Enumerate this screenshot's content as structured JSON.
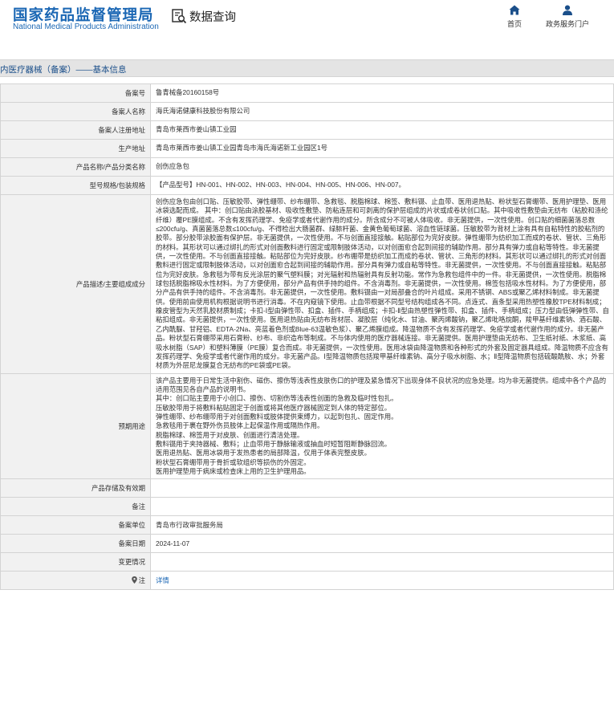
{
  "header": {
    "logo_title": "国家药品监督管理局",
    "logo_subtitle": "National Medical Products Administration",
    "query_label": "数据查询",
    "query_icon": "document-search-icon",
    "nav": [
      {
        "label": "首页",
        "icon": "home-icon"
      },
      {
        "label": "政务服务门户",
        "icon": "user-icon"
      }
    ]
  },
  "section": {
    "title": "内医疗器械（备案）——基本信息"
  },
  "rows": {
    "record_no": {
      "label": "备案号",
      "value": "鲁青械备20160158号"
    },
    "applicant": {
      "label": "备案人名称",
      "value": "海氏海诺健康科技股份有限公司"
    },
    "reg_address": {
      "label": "备案人注册地址",
      "value": "青岛市莱西市姜山镇工业园"
    },
    "prod_address": {
      "label": "生产地址",
      "value": "青岛市莱西市姜山镇工业园青岛市海氏海诺新工业园区1号"
    },
    "product_name": {
      "label": "产品名称/产品分类名称",
      "value": "创伤应急包"
    },
    "model_spec": {
      "label": "型号规格/包装规格",
      "value": "【产品型号】HN-001、HN-002、HN-003、HN-004、HN-005、HN-006、HN-007。"
    },
    "description": {
      "label": "产品描述/主要组成成分",
      "value": "创伤应急包由创口贴、压敏胶带、弹性绷带、纱布绷带、急救毯、脱脂棉球、棉签、敷料镊、止血带、医用退热贴、粉状型石膏绷带、医用护理垫、医用冰袋选配而成。 其中：创口贴由涂胶基材、吸收性敷垫、防粘连层和可剥离的保护层组成的片状或成卷状创口贴。其中吸收性敷垫由无纺布（粘胶和涤纶纤维）覆PE膜组成。不含有发挥药理学、免疫学或者代谢作用的成分。所含成分不可被人体吸收。非无菌提供，一次性使用。创口贴的细菌菌落总数≤200cfu/g、真菌菌落总数≤100cfu/g、不得检出大肠菌群、绿脓杆菌、金黄色葡萄球菌、溶血性链球菌。压敏胶带为背材上涂有具有自粘特性的胶粘剂的胶带。部分胶带涂胶面有保护层。非无菌提供，一次性使用。不与创面直接接触。粘贴部位为完好皮肤。弹性绷带为纺织加工而成的卷状、管状、三角形的材料。其形状可以通过绑扎的形式对创面敷料进行固定或限制肢体活动，以对创面愈合起到间接的辅助作用。部分具有弹力或自粘等特性。非无菌提供，一次性使用。不与创面直接接触。粘贴部位为完好皮肤。纱布绷带是纺织加工而成的卷状、管状、三角形的材料。其形状可以通过绑扎的形式对创面敷料进行固定或限制肢体活动，以对创面愈合起到间接的辅助作用。部分具有弹力或自粘等特性。非无菌提供，一次性使用。不与创面直接接触。粘贴部位为完好皮肤。急救毯为带有反光涂层的聚气塑料膜；对光辐射和热辐射具有反射功能。常作为急救包组件中的一件。非无菌提供，一次性使用。脱脂棉球包括脱脂棉吸水性材料。为了方便使用，部分产品有供手持的组件。不含消毒剂。非无菌提供，一次性使用。棉签包括吸水性材料。为了方便使用，部分产品有供手持的组件。不含消毒剂。非无菌提供，一次性使用。敷料镊由一对局部叠合的叶片组成。采用不锈钢、ABS或聚乙烯材料制成。非无菌提供。使用前由使用机构根据说明书进行消毒。不在内窥镜下使用。止血带根据不同型号结构组成各不同。点连式、直条型采用热塑性橡胶TPE材料制成；橡皮管型为天然乳胶材质制成；卡扣-Ⅰ型由弹性带、扣盒、插件、手柄组成；卡扣-Ⅱ型由热塑性弹性带、扣盒、插件、手柄组成；压力型由低弹弹性带、自粘扣组成。非无菌提供，一次性使用。医用退热贴由无纺布背材层、凝胶层（纯化水、甘油、聚丙烯酸钠，聚乙烯吡咯烷酮，羧甲基纤维素钠、酒石酸、乙内酰脲、甘羟铝、EDTA-2Na、亮蓝着色剂或Blue-63温敏色浆）、聚乙烯膜组成。降温物质不含有发挥药理学、免疫学或者代谢作用的成分。非无菌产品。粉状型石膏绷带采用石膏粉、纱布、非织造布等制成。不与体内使用的医疗器械连接。非无菌提供。医用护理垫由无纺布、卫生纸衬纸、木浆纸、高吸水树脂（SAP）和塑料薄膜（PE膜）复合而成。非无菌提供，一次性使用。医用冰袋由降温物质和各种形式的外套及固定器具组成。降温物质不应含有发挥药理学、免疫学或者代谢作用的成分。非无菌产品。Ⅰ型降温物质包括羧甲基纤维素钠、高分子吸水树脂、水；Ⅱ型降温物质包括硫酸酰胺、水；外套材质为外层尼龙膜复合无纺布的PE袋或PE袋。"
    },
    "intended_use": {
      "label": "预期用途",
      "lines": [
        "该产品主要用于日常生活中割伤、磁伤、擦伤等浅表性皮肤伤口的护理及紧急情况下出现身体不良状况的应急处理。均为非无菌提供。组成中各个产品的适用范围见各自产品的说明书。",
        "其中：创口贴主要用于小创口、擦伤、切割伤等浅表性创面的急救及临时性包扎。",
        "压敏胶带用于将敷料粘贴固定于创面或将其他医疗器械固定到人体的特定部位。",
        "弹性绷带、纱布绷带用于对创面敷料或肢体提供束缚力，以起到包扎、固定作用。",
        "急救毯用于裹在野外伤员肢体上起保温作用或隔热作用。",
        "脱脂棉球、棉签用于对皮肤、创面进行清洁处理。",
        "敷料镊用于夹持器械、敷料；止血带用于静脉输液或抽血时短暂阻断静脉回流。",
        "医用退热贴、医用冰袋用于发热患者的局部降温，仅用于体表完整皮肤。",
        "粉状型石膏绷带用于骨折或软组织等损伤的外固定。",
        "医用护理垫用于病床或检查床上用的卫生护理用品。"
      ]
    },
    "storage": {
      "label": "产品存储及有效期",
      "value": ""
    },
    "remark": {
      "label": "备注",
      "value": ""
    },
    "agency": {
      "label": "备案单位",
      "value": "青岛市行政审批服务局"
    },
    "date": {
      "label": "备案日期",
      "value": "2024-11-07"
    },
    "changes": {
      "label": "变更情况",
      "value": ""
    },
    "note": {
      "label": "注",
      "label_icon": "location-pin-icon",
      "value": "详情"
    }
  }
}
